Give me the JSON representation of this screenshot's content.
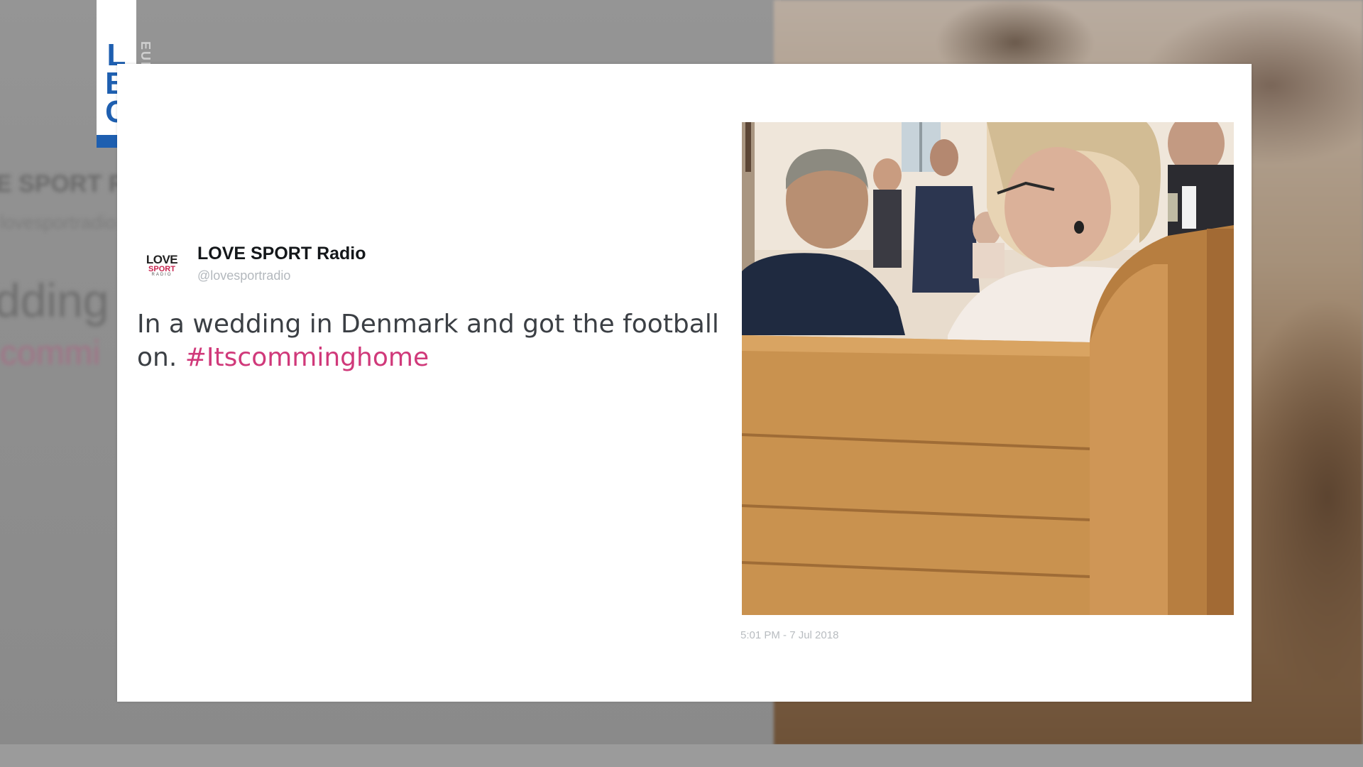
{
  "channel": {
    "logo_letters": "LBC",
    "logo_sub": "EUROPE"
  },
  "tweet": {
    "avatar": {
      "line1": "LOVE",
      "line2": "SPORT",
      "line3": "RADIO"
    },
    "display_name": "LOVE SPORT Radio",
    "handle": "@lovesportradio",
    "text": "In a wedding in Denmark and got the football on.",
    "hashtag": "#Itscomminghome",
    "timestamp": "5:01 PM - 7 Jul 2018"
  },
  "background_ghost": {
    "line1": "E SPORT R",
    "line2": "lovesportradio",
    "line3": "dding i",
    "line4": "commi"
  }
}
